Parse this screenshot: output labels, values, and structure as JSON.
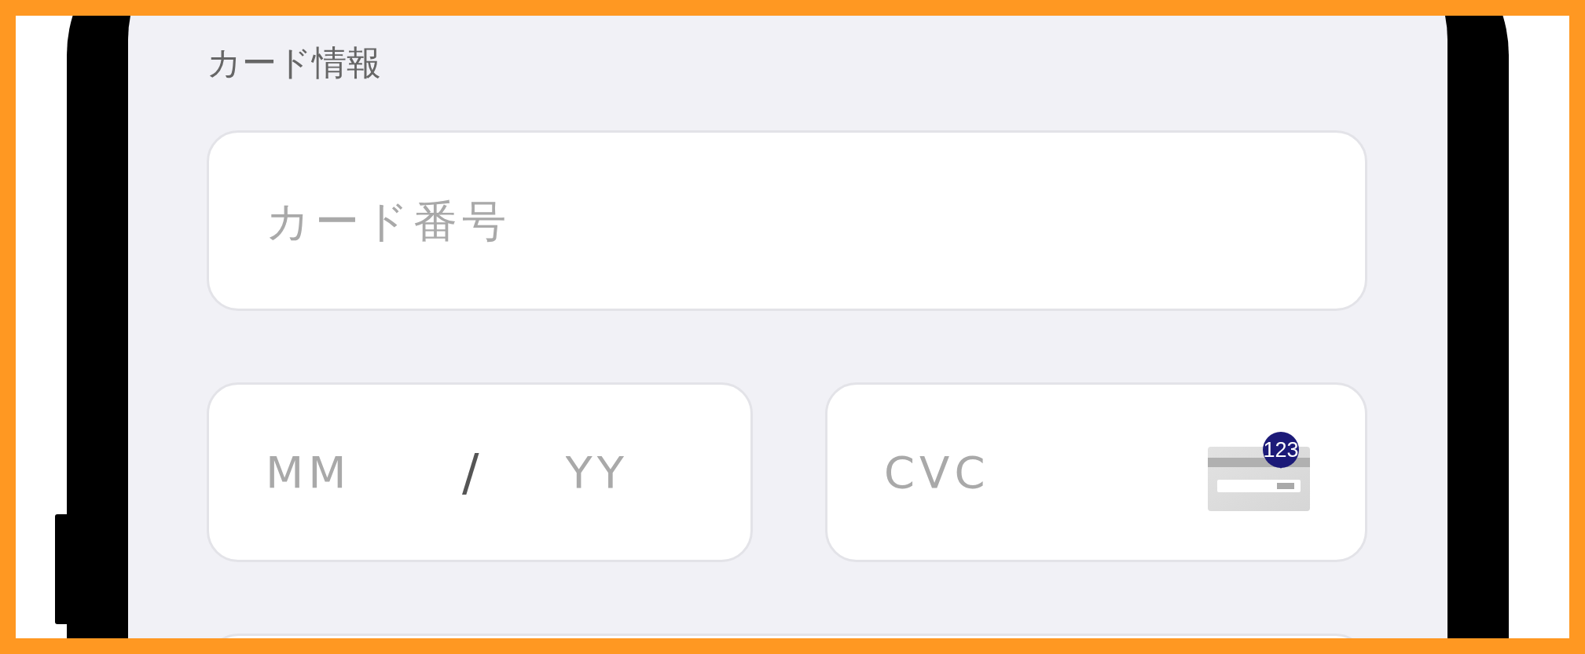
{
  "section_title": "カード情報",
  "card_number": {
    "placeholder": "カード番号"
  },
  "expiry": {
    "month_placeholder": "MM",
    "separator": "/",
    "year_placeholder": "YY"
  },
  "cvc": {
    "placeholder": "CVC",
    "badge": "123"
  }
}
